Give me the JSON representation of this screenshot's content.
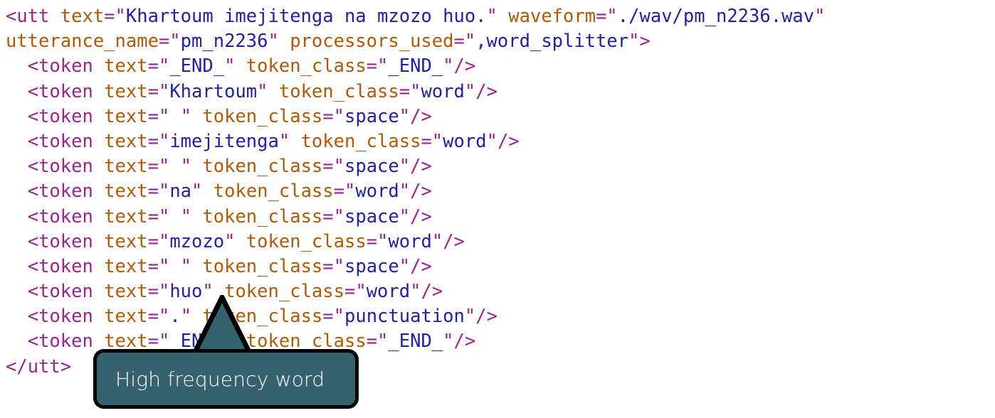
{
  "document": {
    "background_color": "#ffffff",
    "kind": "xml-code-listing"
  },
  "syntax_colors": {
    "tag": "#9c2291",
    "attribute_name": "#b35806",
    "punctuation": "#9c2291",
    "value": "#2020a8"
  },
  "code": {
    "lines": [
      {
        "indent": 0,
        "parts": [
          {
            "cls": "tag",
            "text": "<utt"
          },
          {
            "cls": "attr",
            "text": " text"
          },
          {
            "cls": "punct",
            "text": "=\""
          },
          {
            "cls": "val",
            "text": "Khartoum imejitenga na mzozo huo."
          },
          {
            "cls": "punct",
            "text": "\""
          },
          {
            "cls": "attr",
            "text": " waveform"
          },
          {
            "cls": "punct",
            "text": "=\""
          },
          {
            "cls": "val",
            "text": "./wav/pm_n2236.wav"
          },
          {
            "cls": "punct",
            "text": "\""
          }
        ]
      },
      {
        "indent": 0,
        "parts": [
          {
            "cls": "attr",
            "text": "utterance_name"
          },
          {
            "cls": "punct",
            "text": "=\""
          },
          {
            "cls": "val",
            "text": "pm_n2236"
          },
          {
            "cls": "punct",
            "text": "\""
          },
          {
            "cls": "attr",
            "text": " processors_used"
          },
          {
            "cls": "punct",
            "text": "=\""
          },
          {
            "cls": "val",
            "text": ",word_splitter"
          },
          {
            "cls": "punct",
            "text": "\""
          },
          {
            "cls": "tag",
            "text": ">"
          }
        ]
      },
      {
        "indent": 1,
        "parts": [
          {
            "cls": "tag",
            "text": "<token"
          },
          {
            "cls": "attr",
            "text": " text"
          },
          {
            "cls": "punct",
            "text": "=\""
          },
          {
            "cls": "val",
            "text": "_END_"
          },
          {
            "cls": "punct",
            "text": "\""
          },
          {
            "cls": "attr",
            "text": " token_class"
          },
          {
            "cls": "punct",
            "text": "=\""
          },
          {
            "cls": "val",
            "text": "_END_"
          },
          {
            "cls": "punct",
            "text": "\""
          },
          {
            "cls": "tag",
            "text": "/>"
          }
        ]
      },
      {
        "indent": 1,
        "parts": [
          {
            "cls": "tag",
            "text": "<token"
          },
          {
            "cls": "attr",
            "text": " text"
          },
          {
            "cls": "punct",
            "text": "=\""
          },
          {
            "cls": "val",
            "text": "Khartoum"
          },
          {
            "cls": "punct",
            "text": "\""
          },
          {
            "cls": "attr",
            "text": " token_class"
          },
          {
            "cls": "punct",
            "text": "=\""
          },
          {
            "cls": "val",
            "text": "word"
          },
          {
            "cls": "punct",
            "text": "\""
          },
          {
            "cls": "tag",
            "text": "/>"
          }
        ]
      },
      {
        "indent": 1,
        "parts": [
          {
            "cls": "tag",
            "text": "<token"
          },
          {
            "cls": "attr",
            "text": " text"
          },
          {
            "cls": "punct",
            "text": "=\""
          },
          {
            "cls": "val",
            "text": " "
          },
          {
            "cls": "punct",
            "text": "\""
          },
          {
            "cls": "attr",
            "text": " token_class"
          },
          {
            "cls": "punct",
            "text": "=\""
          },
          {
            "cls": "val",
            "text": "space"
          },
          {
            "cls": "punct",
            "text": "\""
          },
          {
            "cls": "tag",
            "text": "/>"
          }
        ]
      },
      {
        "indent": 1,
        "parts": [
          {
            "cls": "tag",
            "text": "<token"
          },
          {
            "cls": "attr",
            "text": " text"
          },
          {
            "cls": "punct",
            "text": "=\""
          },
          {
            "cls": "val",
            "text": "imejitenga"
          },
          {
            "cls": "punct",
            "text": "\""
          },
          {
            "cls": "attr",
            "text": " token_class"
          },
          {
            "cls": "punct",
            "text": "=\""
          },
          {
            "cls": "val",
            "text": "word"
          },
          {
            "cls": "punct",
            "text": "\""
          },
          {
            "cls": "tag",
            "text": "/>"
          }
        ]
      },
      {
        "indent": 1,
        "parts": [
          {
            "cls": "tag",
            "text": "<token"
          },
          {
            "cls": "attr",
            "text": " text"
          },
          {
            "cls": "punct",
            "text": "=\""
          },
          {
            "cls": "val",
            "text": " "
          },
          {
            "cls": "punct",
            "text": "\""
          },
          {
            "cls": "attr",
            "text": " token_class"
          },
          {
            "cls": "punct",
            "text": "=\""
          },
          {
            "cls": "val",
            "text": "space"
          },
          {
            "cls": "punct",
            "text": "\""
          },
          {
            "cls": "tag",
            "text": "/>"
          }
        ]
      },
      {
        "indent": 1,
        "parts": [
          {
            "cls": "tag",
            "text": "<token"
          },
          {
            "cls": "attr",
            "text": " text"
          },
          {
            "cls": "punct",
            "text": "=\""
          },
          {
            "cls": "val",
            "text": "na"
          },
          {
            "cls": "punct",
            "text": "\""
          },
          {
            "cls": "attr",
            "text": " token_class"
          },
          {
            "cls": "punct",
            "text": "=\""
          },
          {
            "cls": "val",
            "text": "word"
          },
          {
            "cls": "punct",
            "text": "\""
          },
          {
            "cls": "tag",
            "text": "/>"
          }
        ]
      },
      {
        "indent": 1,
        "parts": [
          {
            "cls": "tag",
            "text": "<token"
          },
          {
            "cls": "attr",
            "text": " text"
          },
          {
            "cls": "punct",
            "text": "=\""
          },
          {
            "cls": "val",
            "text": " "
          },
          {
            "cls": "punct",
            "text": "\""
          },
          {
            "cls": "attr",
            "text": " token_class"
          },
          {
            "cls": "punct",
            "text": "=\""
          },
          {
            "cls": "val",
            "text": "space"
          },
          {
            "cls": "punct",
            "text": "\""
          },
          {
            "cls": "tag",
            "text": "/>"
          }
        ]
      },
      {
        "indent": 1,
        "parts": [
          {
            "cls": "tag",
            "text": "<token"
          },
          {
            "cls": "attr",
            "text": " text"
          },
          {
            "cls": "punct",
            "text": "=\""
          },
          {
            "cls": "val",
            "text": "mzozo"
          },
          {
            "cls": "punct",
            "text": "\""
          },
          {
            "cls": "attr",
            "text": " token_class"
          },
          {
            "cls": "punct",
            "text": "=\""
          },
          {
            "cls": "val",
            "text": "word"
          },
          {
            "cls": "punct",
            "text": "\""
          },
          {
            "cls": "tag",
            "text": "/>"
          }
        ]
      },
      {
        "indent": 1,
        "parts": [
          {
            "cls": "tag",
            "text": "<token"
          },
          {
            "cls": "attr",
            "text": " text"
          },
          {
            "cls": "punct",
            "text": "=\""
          },
          {
            "cls": "val",
            "text": " "
          },
          {
            "cls": "punct",
            "text": "\""
          },
          {
            "cls": "attr",
            "text": " token_class"
          },
          {
            "cls": "punct",
            "text": "=\""
          },
          {
            "cls": "val",
            "text": "space"
          },
          {
            "cls": "punct",
            "text": "\""
          },
          {
            "cls": "tag",
            "text": "/>"
          }
        ]
      },
      {
        "indent": 1,
        "parts": [
          {
            "cls": "tag",
            "text": "<token"
          },
          {
            "cls": "attr",
            "text": " text"
          },
          {
            "cls": "punct",
            "text": "=\""
          },
          {
            "cls": "val",
            "text": "huo"
          },
          {
            "cls": "punct",
            "text": "\""
          },
          {
            "cls": "attr",
            "text": " token_class"
          },
          {
            "cls": "punct",
            "text": "=\""
          },
          {
            "cls": "val",
            "text": "word"
          },
          {
            "cls": "punct",
            "text": "\""
          },
          {
            "cls": "tag",
            "text": "/>"
          }
        ]
      },
      {
        "indent": 1,
        "parts": [
          {
            "cls": "tag",
            "text": "<token"
          },
          {
            "cls": "attr",
            "text": " text"
          },
          {
            "cls": "punct",
            "text": "=\""
          },
          {
            "cls": "val",
            "text": "."
          },
          {
            "cls": "punct",
            "text": "\""
          },
          {
            "cls": "attr",
            "text": " token_class"
          },
          {
            "cls": "punct",
            "text": "=\""
          },
          {
            "cls": "val",
            "text": "punctuation"
          },
          {
            "cls": "punct",
            "text": "\""
          },
          {
            "cls": "tag",
            "text": "/>"
          }
        ]
      },
      {
        "indent": 1,
        "parts": [
          {
            "cls": "tag",
            "text": "<token"
          },
          {
            "cls": "attr",
            "text": " text"
          },
          {
            "cls": "punct",
            "text": "=\""
          },
          {
            "cls": "val",
            "text": "_END_"
          },
          {
            "cls": "punct",
            "text": "\""
          },
          {
            "cls": "attr",
            "text": " token_class"
          },
          {
            "cls": "punct",
            "text": "=\""
          },
          {
            "cls": "val",
            "text": "_END_"
          },
          {
            "cls": "punct",
            "text": "\""
          },
          {
            "cls": "tag",
            "text": "/>"
          }
        ]
      },
      {
        "indent": 0,
        "parts": [
          {
            "cls": "tag",
            "text": "</utt>"
          }
        ]
      }
    ]
  },
  "callout": {
    "label": "High frequency word",
    "fill_color": "#36616f",
    "border_color": "#000000",
    "text_color": "#ffffff",
    "tail_direction": "up"
  }
}
